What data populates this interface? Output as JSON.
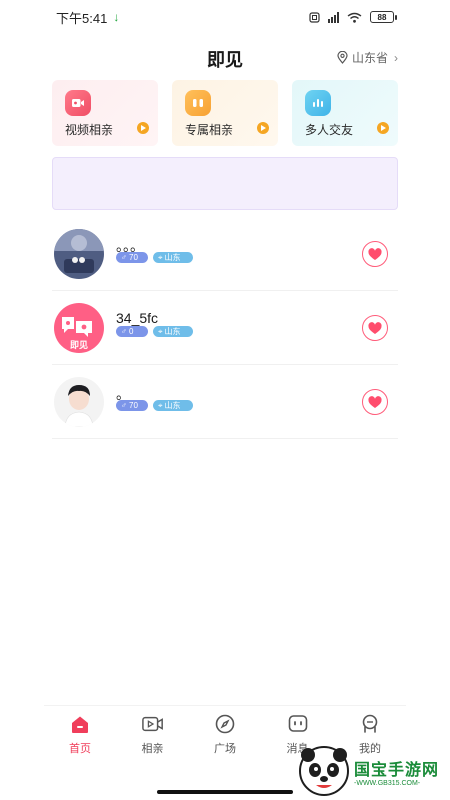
{
  "status_bar": {
    "time": "下午5:41",
    "battery": "88"
  },
  "header": {
    "title": "即见",
    "location": "山东省"
  },
  "categories": [
    {
      "label": "视频相亲",
      "icon": "video-icon"
    },
    {
      "label": "专属相亲",
      "icon": "couple-icon"
    },
    {
      "label": "多人交友",
      "icon": "group-chart-icon"
    }
  ],
  "users": [
    {
      "name": "。。。",
      "age": "70",
      "location": "山东"
    },
    {
      "name": "34_5fc",
      "age": "0",
      "location": "山东"
    },
    {
      "name": "。",
      "age": "70",
      "location": "山东"
    }
  ],
  "avatar_brand_text": "即见",
  "bottom_nav": [
    {
      "label": "首页",
      "icon": "home-icon",
      "active": true
    },
    {
      "label": "相亲",
      "icon": "video-camera-icon",
      "active": false
    },
    {
      "label": "广场",
      "icon": "compass-icon",
      "active": false
    },
    {
      "label": "消息",
      "icon": "message-icon",
      "active": false
    },
    {
      "label": "我的",
      "icon": "profile-icon",
      "active": false
    }
  ],
  "watermark": {
    "title": "国宝手游网",
    "url": "-WWW.GB315.COM-"
  },
  "colors": {
    "accent": "#f03e5b",
    "age_tag": "#7c95e9",
    "location_tag": "#6fbde9",
    "banner": "#f4effd"
  }
}
